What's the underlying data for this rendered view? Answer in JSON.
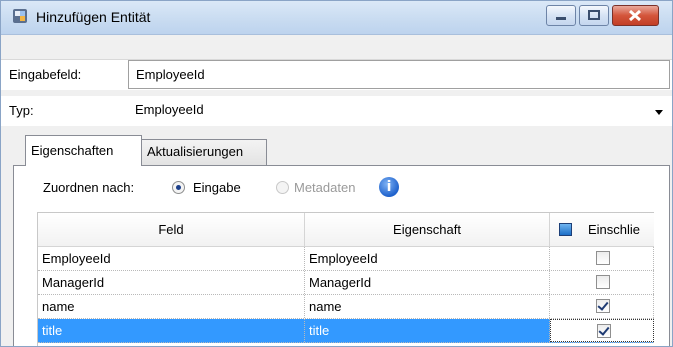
{
  "window": {
    "title": "Hinzufügen Entität"
  },
  "form": {
    "input_label": "Eingabefeld:",
    "input_value": "EmployeeId",
    "ellipsis_label": "...",
    "type_label": "Typ:",
    "type_value": "EmployeeId"
  },
  "tabs": [
    {
      "label": "Eigenschaften",
      "active": true
    },
    {
      "label": "Aktualisierungen",
      "active": false
    }
  ],
  "mapping": {
    "label": "Zuordnen nach:",
    "options": [
      {
        "label": "Eingabe",
        "selected": true,
        "enabled": true
      },
      {
        "label": "Metadaten",
        "selected": false,
        "enabled": false
      }
    ],
    "info_icon": "i"
  },
  "grid": {
    "columns": [
      "Feld",
      "Eigenschaft",
      "Einschlie"
    ],
    "rows": [
      {
        "feld": "EmployeeId",
        "eigenschaft": "EmployeeId",
        "include": false,
        "selected": false
      },
      {
        "feld": "ManagerId",
        "eigenschaft": "ManagerId",
        "include": false,
        "selected": false
      },
      {
        "feld": "name",
        "eigenschaft": "name",
        "include": true,
        "selected": false
      },
      {
        "feld": "title",
        "eigenschaft": "title",
        "include": true,
        "selected": true
      }
    ]
  },
  "colors": {
    "selection": "#3399ff",
    "close_button": "#c23f26"
  }
}
